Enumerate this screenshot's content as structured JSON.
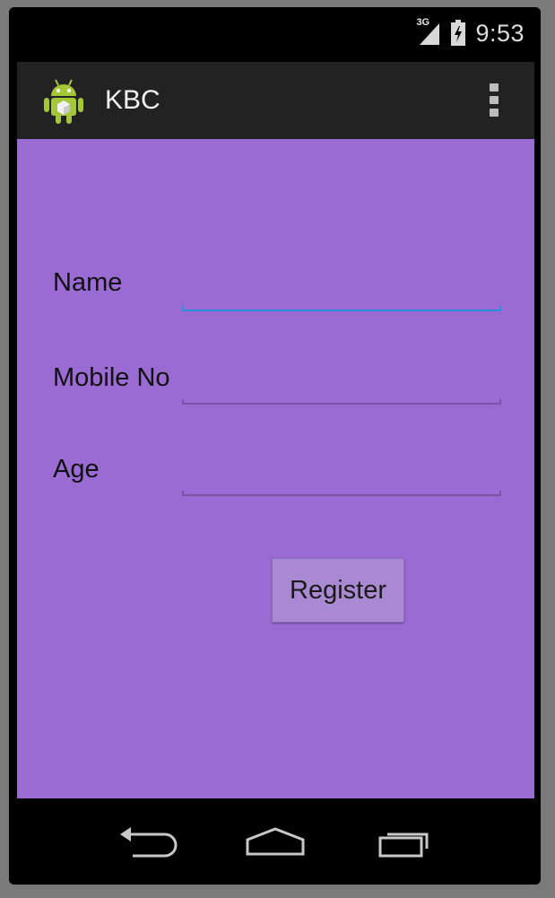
{
  "status_bar": {
    "network_label": "3G",
    "time": "9:53"
  },
  "action_bar": {
    "title": "KBC",
    "app_icon": "android-icon",
    "overflow_icon": "overflow-menu-icon"
  },
  "form": {
    "name_label": "Name",
    "name_value": "",
    "mobile_label": "Mobile No",
    "mobile_value": "",
    "age_label": "Age",
    "age_value": "",
    "register_label": "Register"
  },
  "nav_bar": {
    "back_icon": "back-icon",
    "home_icon": "home-icon",
    "recents_icon": "recent-apps-icon"
  },
  "colors": {
    "content_background": "#9b6bd4",
    "action_bar": "#222222",
    "focus_accent": "#2a8fd8",
    "android_green": "#a4c639"
  }
}
